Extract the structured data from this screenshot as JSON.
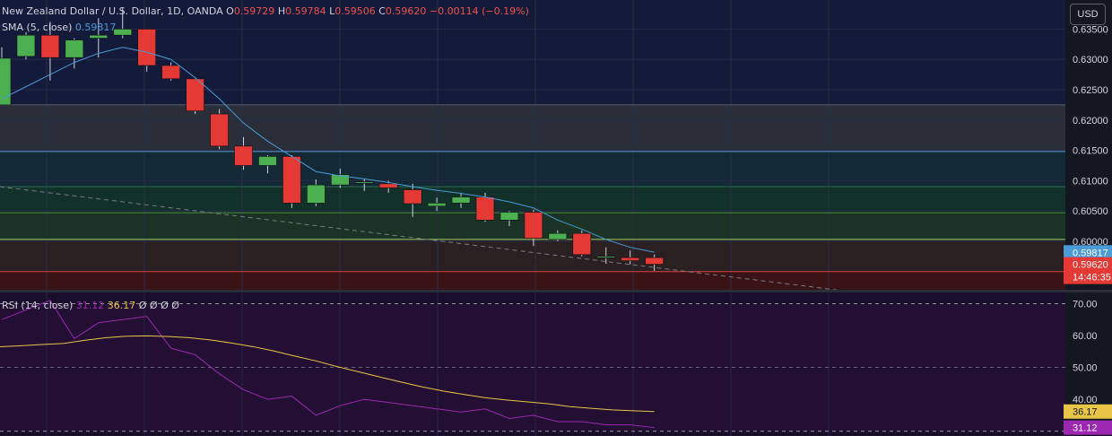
{
  "header": {
    "symbol": "New Zealand Dollar / U.S. Dollar, 1D, OANDA",
    "o_label": "O",
    "o": "0.59729",
    "h_label": "H",
    "h": "0.59784",
    "l_label": "L",
    "l": "0.59506",
    "c_label": "C",
    "c": "0.59620",
    "change": "−0.00114 (−0.19%)",
    "currency_button": "USD"
  },
  "sma_legend": {
    "label": "SMA (5, close)",
    "value": "0.59817"
  },
  "rsi_legend": {
    "label": "RSI (14, close)",
    "value_rsi": "31.12",
    "value_ma": "36.17",
    "extras": "Ø Ø Ø Ø"
  },
  "price_tags": {
    "sma": "0.59817",
    "close": "0.59620",
    "countdown": "14:46:35"
  },
  "colors": {
    "up": "#4caf50",
    "down": "#e53935",
    "sma": "#4a9bd8",
    "rsi": "#9c27b0",
    "rsi_ma": "#e8c547",
    "trend": "#787b86"
  },
  "chart_data": [
    {
      "type": "candlestick",
      "title": "New Zealand Dollar / U.S. Dollar, 1D, OANDA",
      "ylim": [
        0.592,
        0.6398
      ],
      "y_ticks": [
        "0.63500",
        "0.63000",
        "0.62500",
        "0.62000",
        "0.61500",
        "0.61000",
        "0.60500",
        "0.60000"
      ],
      "candles": [
        {
          "o": 0.6225,
          "h": 0.632,
          "l": 0.6225,
          "c": 0.6302
        },
        {
          "o": 0.6305,
          "h": 0.6345,
          "l": 0.63,
          "c": 0.634
        },
        {
          "o": 0.634,
          "h": 0.6362,
          "l": 0.6265,
          "c": 0.6303
        },
        {
          "o": 0.6303,
          "h": 0.6335,
          "l": 0.6285,
          "c": 0.6332
        },
        {
          "o": 0.6335,
          "h": 0.6368,
          "l": 0.6303,
          "c": 0.634
        },
        {
          "o": 0.634,
          "h": 0.6385,
          "l": 0.6335,
          "c": 0.635
        },
        {
          "o": 0.635,
          "h": 0.635,
          "l": 0.628,
          "c": 0.629
        },
        {
          "o": 0.629,
          "h": 0.6295,
          "l": 0.6265,
          "c": 0.6268
        },
        {
          "o": 0.6268,
          "h": 0.627,
          "l": 0.621,
          "c": 0.6215
        },
        {
          "o": 0.621,
          "h": 0.6218,
          "l": 0.6152,
          "c": 0.6157
        },
        {
          "o": 0.6157,
          "h": 0.6172,
          "l": 0.6118,
          "c": 0.6125
        },
        {
          "o": 0.6125,
          "h": 0.6142,
          "l": 0.6112,
          "c": 0.614
        },
        {
          "o": 0.614,
          "h": 0.6142,
          "l": 0.6055,
          "c": 0.6063
        },
        {
          "o": 0.6063,
          "h": 0.6102,
          "l": 0.6058,
          "c": 0.6093
        },
        {
          "o": 0.6093,
          "h": 0.612,
          "l": 0.6088,
          "c": 0.611
        },
        {
          "o": 0.6097,
          "h": 0.6103,
          "l": 0.6083,
          "c": 0.6098
        },
        {
          "o": 0.6095,
          "h": 0.61,
          "l": 0.608,
          "c": 0.6088
        },
        {
          "o": 0.6085,
          "h": 0.6095,
          "l": 0.604,
          "c": 0.6062
        },
        {
          "o": 0.6058,
          "h": 0.6072,
          "l": 0.605,
          "c": 0.6063
        },
        {
          "o": 0.6063,
          "h": 0.608,
          "l": 0.6055,
          "c": 0.6073
        },
        {
          "o": 0.6073,
          "h": 0.608,
          "l": 0.6032,
          "c": 0.6035
        },
        {
          "o": 0.6035,
          "h": 0.605,
          "l": 0.6025,
          "c": 0.6048
        },
        {
          "o": 0.6048,
          "h": 0.6052,
          "l": 0.5992,
          "c": 0.6005
        },
        {
          "o": 0.6003,
          "h": 0.6018,
          "l": 0.6,
          "c": 0.6013
        },
        {
          "o": 0.6013,
          "h": 0.6018,
          "l": 0.5975,
          "c": 0.5978
        },
        {
          "o": 0.5973,
          "h": 0.599,
          "l": 0.5963,
          "c": 0.5975
        },
        {
          "o": 0.5973,
          "h": 0.5985,
          "l": 0.5962,
          "c": 0.5968
        },
        {
          "o": 0.5973,
          "h": 0.5978,
          "l": 0.5951,
          "c": 0.5962
        }
      ],
      "sma": [
        0.6235,
        0.6255,
        0.6275,
        0.6295,
        0.631,
        0.632,
        0.6312,
        0.63,
        0.627,
        0.6235,
        0.6195,
        0.6165,
        0.614,
        0.6115,
        0.6108,
        0.6103,
        0.6097,
        0.609,
        0.6084,
        0.6079,
        0.6073,
        0.6065,
        0.6055,
        0.6035,
        0.602,
        0.6003,
        0.599,
        0.5982
      ],
      "sma_value": 0.59817,
      "horizontal_levels": [
        {
          "value": 0.6225,
          "color": "#5d606b"
        },
        {
          "value": 0.6148,
          "color": "#5b9bd5"
        },
        {
          "value": 0.609,
          "color": "#2e6b4c"
        },
        {
          "value": 0.6047,
          "color": "#4c8a3c"
        },
        {
          "value": 0.6003,
          "color": "#9fcf6a"
        },
        {
          "value": 0.595,
          "color": "#d94040"
        }
      ],
      "zones": [
        {
          "from": 0.6225,
          "to": 0.6148,
          "color": "#2a2e39"
        },
        {
          "from": 0.6148,
          "to": 0.609,
          "color": "#132a36"
        },
        {
          "from": 0.609,
          "to": 0.6047,
          "color": "#11312a"
        },
        {
          "from": 0.6047,
          "to": 0.6003,
          "color": "#1a3324"
        },
        {
          "from": 0.6003,
          "to": 0.595,
          "color": "#2a2022"
        },
        {
          "from": 0.595,
          "to": 0.5905,
          "color": "#3a1316"
        }
      ],
      "trendline": {
        "from_index": 0,
        "from_value": 0.609,
        "to_index": 37,
        "to_value": 0.5908
      }
    },
    {
      "type": "line",
      "title": "RSI (14, close)",
      "ylim": [
        28.5,
        73.5
      ],
      "y_ticks": [
        "70.00",
        "60.00",
        "50.00",
        "40.00"
      ],
      "levels": [
        70,
        50,
        30
      ],
      "series": [
        {
          "name": "RSI",
          "values": [
            65,
            68,
            71,
            59,
            64,
            65,
            66,
            56,
            54,
            48,
            43,
            40,
            41,
            35,
            38,
            40,
            39,
            38,
            37,
            36,
            37,
            34,
            35,
            33,
            33,
            32,
            32,
            31.12
          ]
        },
        {
          "name": "RSI MA",
          "values": [
            56.5,
            56.8,
            57.2,
            57.5,
            58.5,
            59.3,
            59.8,
            59.9,
            59.7,
            59.3,
            58.6,
            57.6,
            56.5,
            55.1,
            53.5,
            52.0,
            50.2,
            48.6,
            47.0,
            45.4,
            43.9,
            42.6,
            41.5,
            40.5,
            39.8,
            39.2,
            38.6,
            37.7,
            37.2,
            36.7,
            36.4,
            36.17
          ]
        }
      ]
    }
  ]
}
